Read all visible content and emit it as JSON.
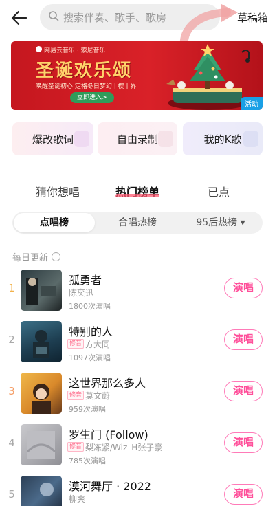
{
  "header": {
    "search_placeholder": "搜索伴奏、歌手、歌房",
    "draft_label": "草稿箱"
  },
  "banner": {
    "brand": "网易云音乐 · 索尼音乐",
    "title": "圣诞欢乐颂",
    "subtitle": "唤醒圣诞初心  定格冬日梦幻 | 楔 | 界",
    "cta": "立即进入>",
    "tag": "活动"
  },
  "quick_cards": [
    {
      "label": "爆改歌词"
    },
    {
      "label": "自由录制"
    },
    {
      "label": "我的K歌"
    }
  ],
  "tabs": [
    {
      "label": "猜你想唱"
    },
    {
      "label": "热门榜单"
    },
    {
      "label": "已点"
    }
  ],
  "segments": [
    {
      "label": "点唱榜"
    },
    {
      "label": "合唱热榜"
    },
    {
      "label": "95后热榜 ▾"
    }
  ],
  "daily_label": "每日更新",
  "sing_label": "演唱",
  "original_badge": "修音",
  "songs": [
    {
      "rank": "1",
      "title": "孤勇者",
      "artist": "陈奕迅",
      "plays": "1800次演唱"
    },
    {
      "rank": "2",
      "title": "特别的人",
      "artist": "方大同",
      "plays": "1097次演唱"
    },
    {
      "rank": "3",
      "title": "这世界那么多人",
      "artist": "莫文蔚",
      "plays": "959次演唱"
    },
    {
      "rank": "4",
      "title": "罗生门 (Follow)",
      "artist": "梨冻紧/Wiz_H张子豪",
      "plays": "785次演唱"
    },
    {
      "rank": "5",
      "title": "漠河舞厅 · 2022",
      "artist": "柳爽",
      "plays": ""
    }
  ],
  "colors": {
    "accent_pink": "#ff4f9a",
    "rank_gold": "#f2b24b",
    "rank_gray": "#aaaaaa",
    "rank_orange": "#f5a06a"
  }
}
